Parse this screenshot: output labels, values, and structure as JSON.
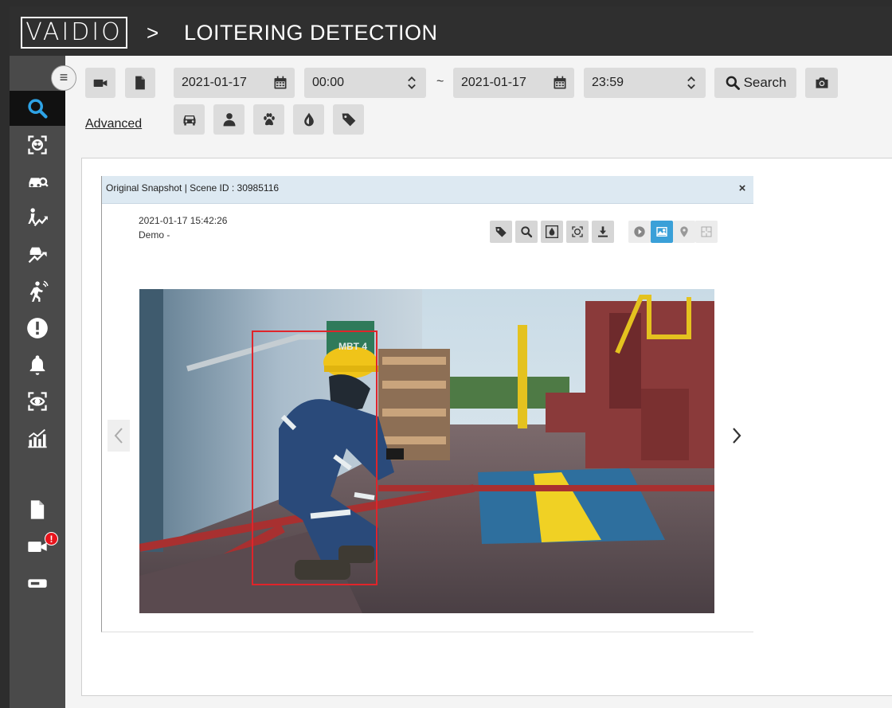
{
  "app": {
    "logo_text": "VAIDIO",
    "breadcrumb_sep": ">",
    "page_title": "LOITERING DETECTION"
  },
  "sidebar": {
    "menu_icon": "hamburger-icon",
    "items": [
      {
        "icon": "search-icon",
        "active": true
      },
      {
        "icon": "face-scan-icon"
      },
      {
        "icon": "car-scan-icon"
      },
      {
        "icon": "person-trend-icon"
      },
      {
        "icon": "vehicle-trend-icon"
      },
      {
        "icon": "person-loitering-icon"
      },
      {
        "icon": "alert-icon"
      },
      {
        "icon": "bell-icon"
      },
      {
        "icon": "eye-scan-icon"
      },
      {
        "icon": "analytics-chart-icon"
      },
      {
        "icon": "report-icon"
      },
      {
        "icon": "camera-icon",
        "badge": "!"
      },
      {
        "icon": "device-icon"
      }
    ]
  },
  "toolbar": {
    "start_date": "2021-01-17",
    "start_time": "00:00",
    "range_sep": "~",
    "end_date": "2021-01-17",
    "end_time": "23:59",
    "search_label": "Search",
    "advanced_label": "Advanced"
  },
  "snapshot": {
    "header": "Original Snapshot | Scene ID : 30985116",
    "close": "×",
    "timestamp": "2021-01-17 15:42:26",
    "camera": "Demo -",
    "photo_text": "MBT 4",
    "active_view": "image"
  },
  "colors": {
    "accent": "#3aa0d8",
    "bbox": "#e0242a",
    "sidebar": "#4a4a4a",
    "header": "#2f2f2f"
  }
}
